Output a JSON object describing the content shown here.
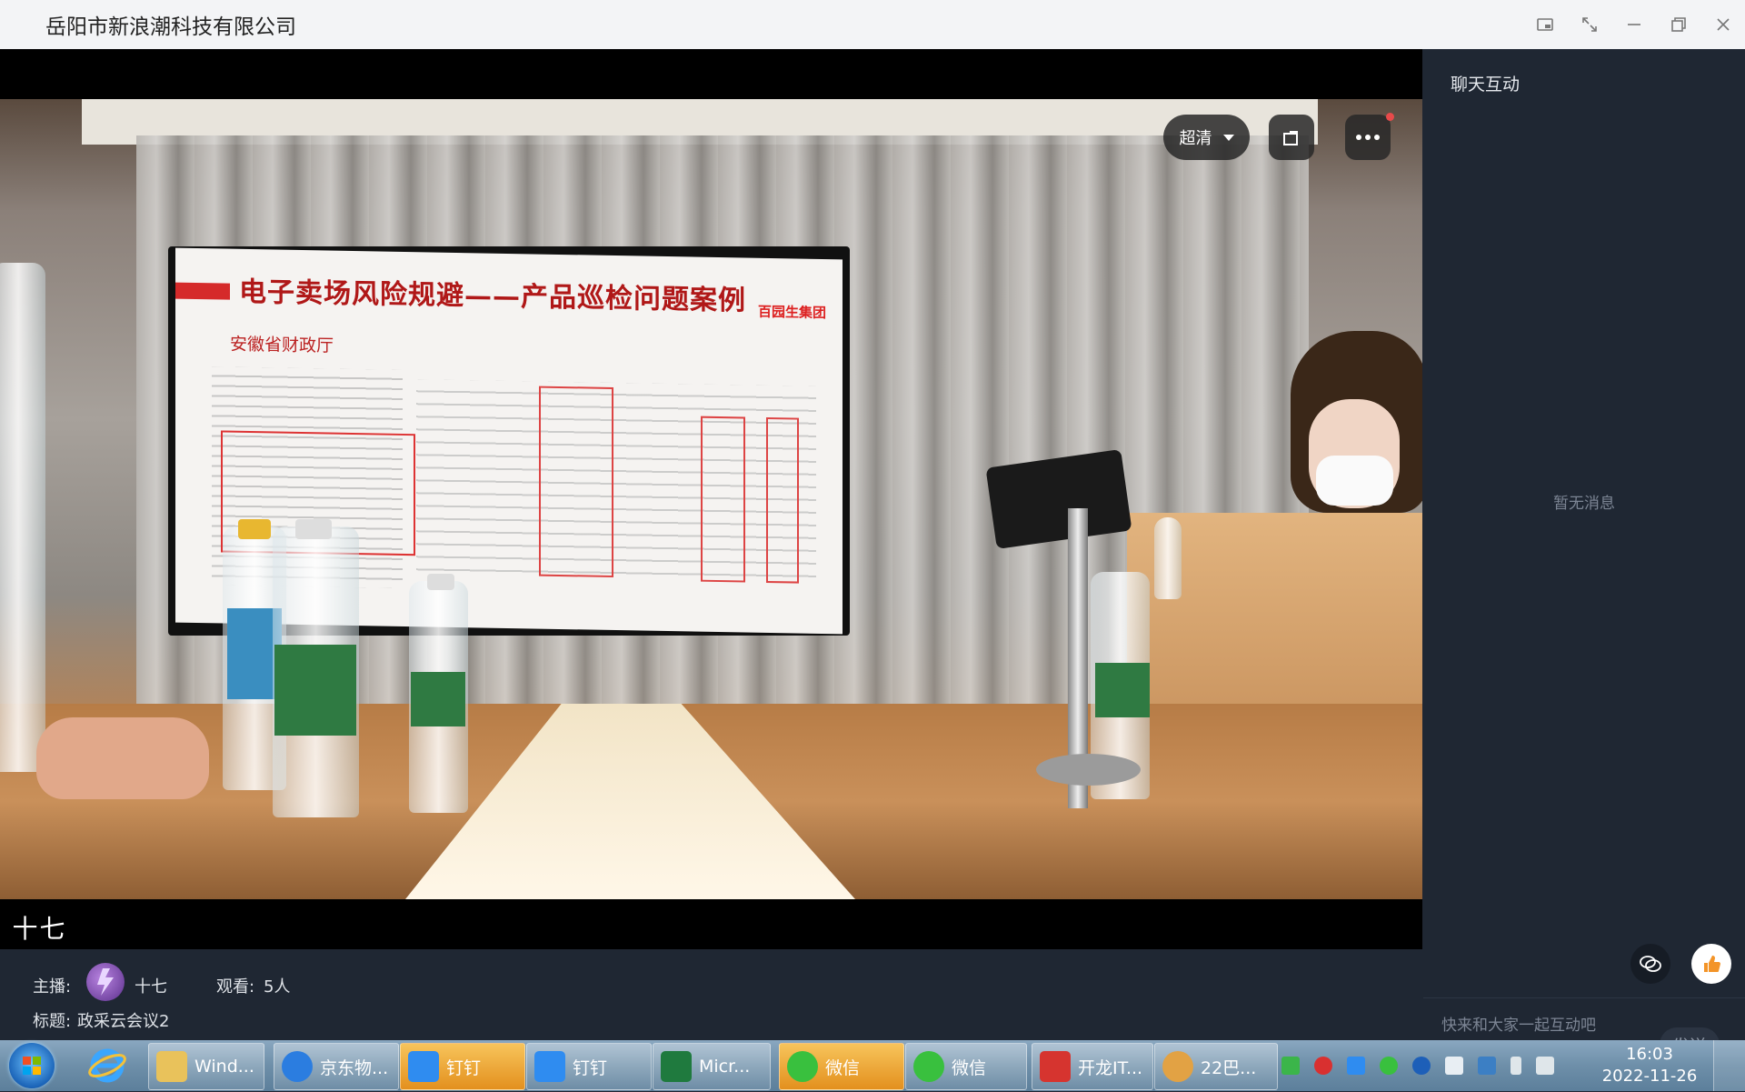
{
  "window": {
    "title": "岳阳市新浪潮科技有限公司"
  },
  "video": {
    "quality_label": "超清",
    "host_name_tag": "十七",
    "slide": {
      "title": "电子卖场风险规避——产品巡检问题案例",
      "logo_text": "百园生集团",
      "doc_title": "安徽省财政厅"
    }
  },
  "chat": {
    "title": "聊天互动",
    "empty_text": "暂无消息",
    "input_placeholder": "快来和大家一起互动吧",
    "send_label": "发送"
  },
  "info": {
    "host_label": "主播:",
    "host_name": "十七",
    "viewers_label": "观看:",
    "viewers_count": "5人",
    "topic_label": "标题:",
    "topic_value": "政采云会议2"
  },
  "taskbar": {
    "items": [
      {
        "label": "Wind...",
        "icon": "folder-icon",
        "color": "#e9c25b"
      },
      {
        "label": "京东物...",
        "icon": "jd-icon",
        "color": "#2b7de0"
      },
      {
        "label": "钉钉",
        "icon": "dingtalk-icon",
        "color": "#2f8cf0",
        "active": true
      },
      {
        "label": "钉钉",
        "icon": "dingtalk-icon",
        "color": "#2f8cf0"
      },
      {
        "label": "Micr...",
        "icon": "excel-icon",
        "color": "#1f7a3e"
      },
      {
        "label": "微信",
        "icon": "wechat-icon",
        "color": "#39c03e",
        "active": true
      },
      {
        "label": "微信",
        "icon": "wechat-icon",
        "color": "#39c03e"
      },
      {
        "label": "开龙IT...",
        "icon": "app-icon",
        "color": "#d6342f"
      },
      {
        "label": "22巴...",
        "icon": "paint-icon",
        "color": "#e2a244"
      }
    ],
    "clock_time": "16:03",
    "clock_date": "2022-11-26"
  },
  "colors": {
    "panel_bg": "#1f2733",
    "accent_red": "#e84a4a"
  }
}
